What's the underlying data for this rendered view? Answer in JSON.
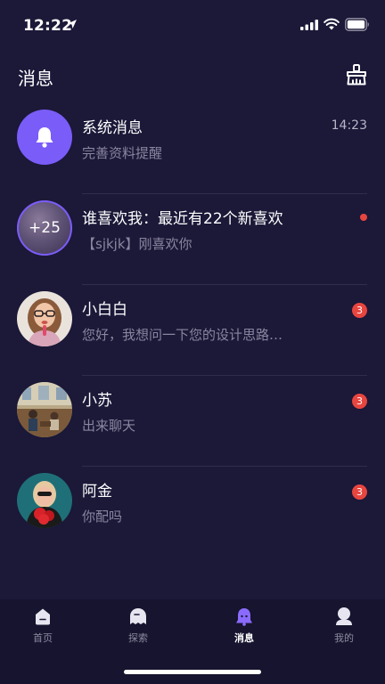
{
  "status_bar": {
    "time": "12:22"
  },
  "header": {
    "title": "消息"
  },
  "conversations": [
    {
      "title": "系统消息",
      "subtitle": "完善资料提醒",
      "time": "14:23",
      "avatar_icon": "bell-icon",
      "avatar_color": "#7a5cf8"
    },
    {
      "title": "谁喜欢我：最近有22个新喜欢",
      "subtitle": "【sjkjk】刚喜欢你",
      "avatar_text": "+25",
      "indicator": "unread-dot"
    },
    {
      "title": "小白白",
      "subtitle": "您好，我想问一下您的设计思路…",
      "badge": "3",
      "avatar_icon": "user-photo"
    },
    {
      "title": "小苏",
      "subtitle": "出来聊天",
      "badge": "3",
      "avatar_icon": "user-photo"
    },
    {
      "title": "阿金",
      "subtitle": "你配吗",
      "badge": "3",
      "avatar_icon": "user-photo"
    }
  ],
  "tab_bar": {
    "tabs": [
      {
        "label": "首页",
        "icon": "home-icon",
        "active": false
      },
      {
        "label": "探索",
        "icon": "explore-icon",
        "active": false
      },
      {
        "label": "消息",
        "icon": "message-icon",
        "active": true
      },
      {
        "label": "我的",
        "icon": "profile-icon",
        "active": false
      }
    ]
  },
  "colors": {
    "background": "#1b1838",
    "accent": "#7a5cf8",
    "badge": "#e8453f",
    "muted_text": "#8a869f"
  }
}
